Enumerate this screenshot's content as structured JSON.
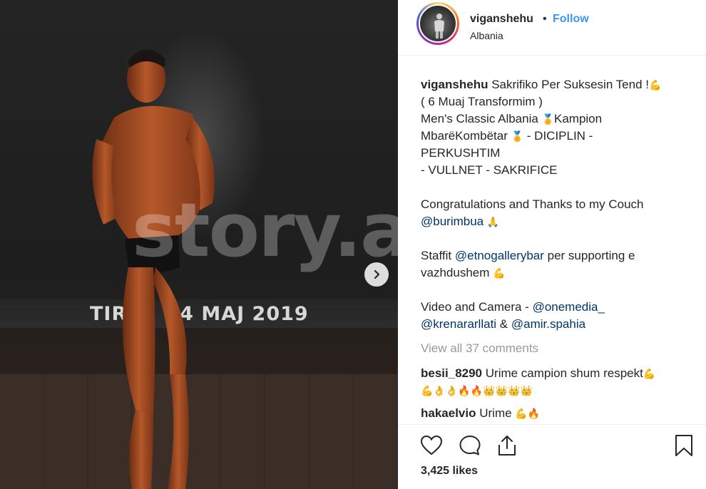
{
  "photo": {
    "banner_text": "TIRA     4 MAJ 2019",
    "watermark": "story.al"
  },
  "header": {
    "username": "viganshehu",
    "separator": "•",
    "follow_label": "Follow",
    "location": "Albania"
  },
  "caption": {
    "username": "viganshehu",
    "line1": "Sakrifiko Per Suksesin Tend !",
    "line2": "( 6 Muaj Transformim )",
    "line3a": "Men's Classic Albania ",
    "line3b": "Kampion",
    "line4a": "MbarëKombëtar ",
    "line4b": " - DICIPLIN -",
    "line5": "PERKUSHTIM",
    "line6": "- VULLNET - SAKRIFICE",
    "thanks": "Congratulations and Thanks to my Couch",
    "mention_coach": "@burimbua",
    "staffit": "Staffit ",
    "mention_bar": "@etnogallerybar",
    "supporting": " per supporting e",
    "vazhdushem": "vazhdushem ",
    "video": "Video and Camera - ",
    "mention_media": "@onemedia_",
    "mention_krenar": "@krenararllati",
    "amp": " & ",
    "mention_amir": "@amir.spahia"
  },
  "comments": {
    "view_all": "View all 37 comments",
    "items": [
      {
        "user": "besii_8290",
        "text": "Urime campion shum respekt"
      },
      {
        "user": "hakaelvio",
        "text": "Urime "
      }
    ]
  },
  "actions": {
    "likes": "3,425 likes"
  },
  "icons": {
    "heart": "heart-icon",
    "comment": "comment-icon",
    "share": "share-icon",
    "save": "bookmark-icon",
    "next": "chevron-right-icon"
  },
  "colors": {
    "link": "#3897f0",
    "mention": "#003569",
    "muted": "#999999"
  }
}
